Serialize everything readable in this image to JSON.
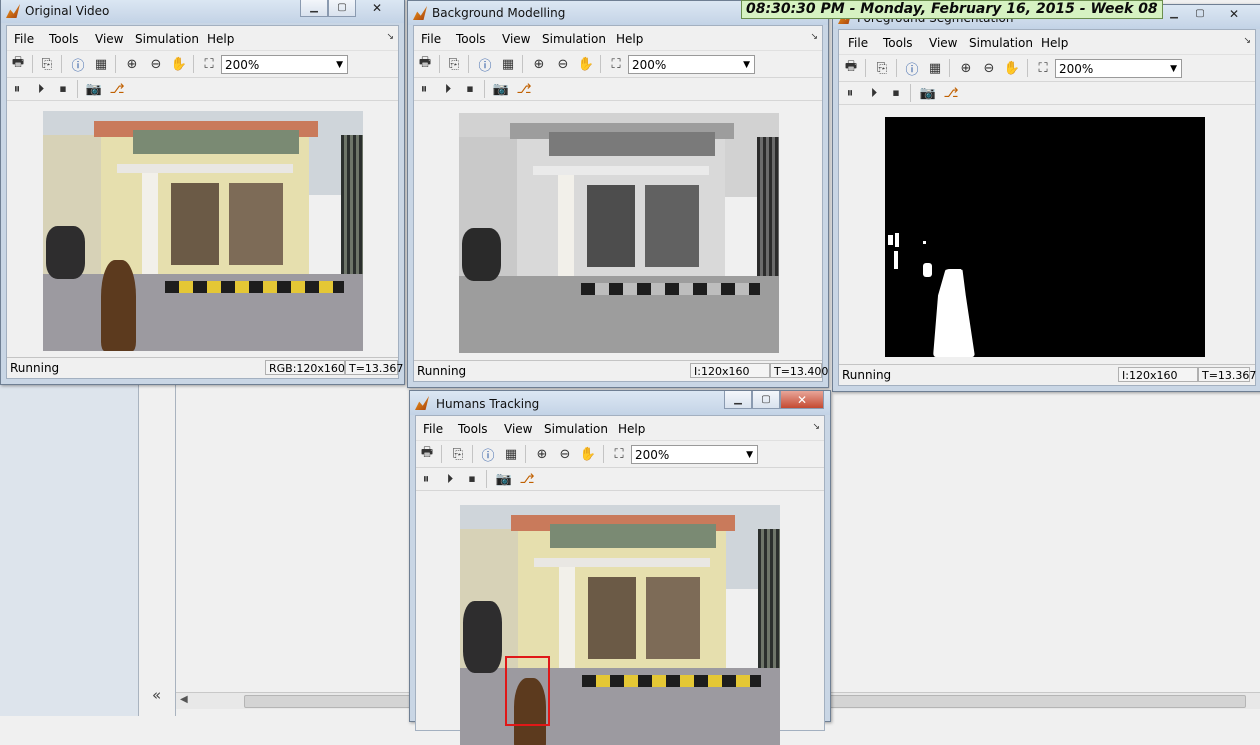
{
  "clock": "08:30:30 PM - Monday, February 16, 2015 - Week 08",
  "menu": [
    "File",
    "Tools",
    "View",
    "Simulation",
    "Help"
  ],
  "zoom_value": "200%",
  "status_running": "Running",
  "windows": {
    "original": {
      "title": "Original Video",
      "size": "RGB:120x160",
      "time": "T=13.367"
    },
    "background": {
      "title": "Background Modelling",
      "size": "I:120x160",
      "time": "T=13.400"
    },
    "foreground": {
      "title": "Foreground Segmentation",
      "size": "I:120x160",
      "time": "T=13.367"
    },
    "tracking": {
      "title": "Humans Tracking"
    }
  },
  "icons": {
    "toolbar1": [
      "print-icon",
      "copy-to-clipboard-icon",
      "info-icon",
      "properties-icon",
      "zoom-in-icon",
      "zoom-out-icon",
      "pan-hand-icon",
      "fit-to-window-icon"
    ],
    "toolbar2": [
      "pause-icon",
      "step-forward-icon",
      "stop-icon",
      "snapshot-camera-icon",
      "highlight-block-icon"
    ]
  },
  "colors": {
    "tracking_box": "#e01818",
    "clock_bg": "#d6f2c2",
    "close_button": "#c44a32"
  }
}
